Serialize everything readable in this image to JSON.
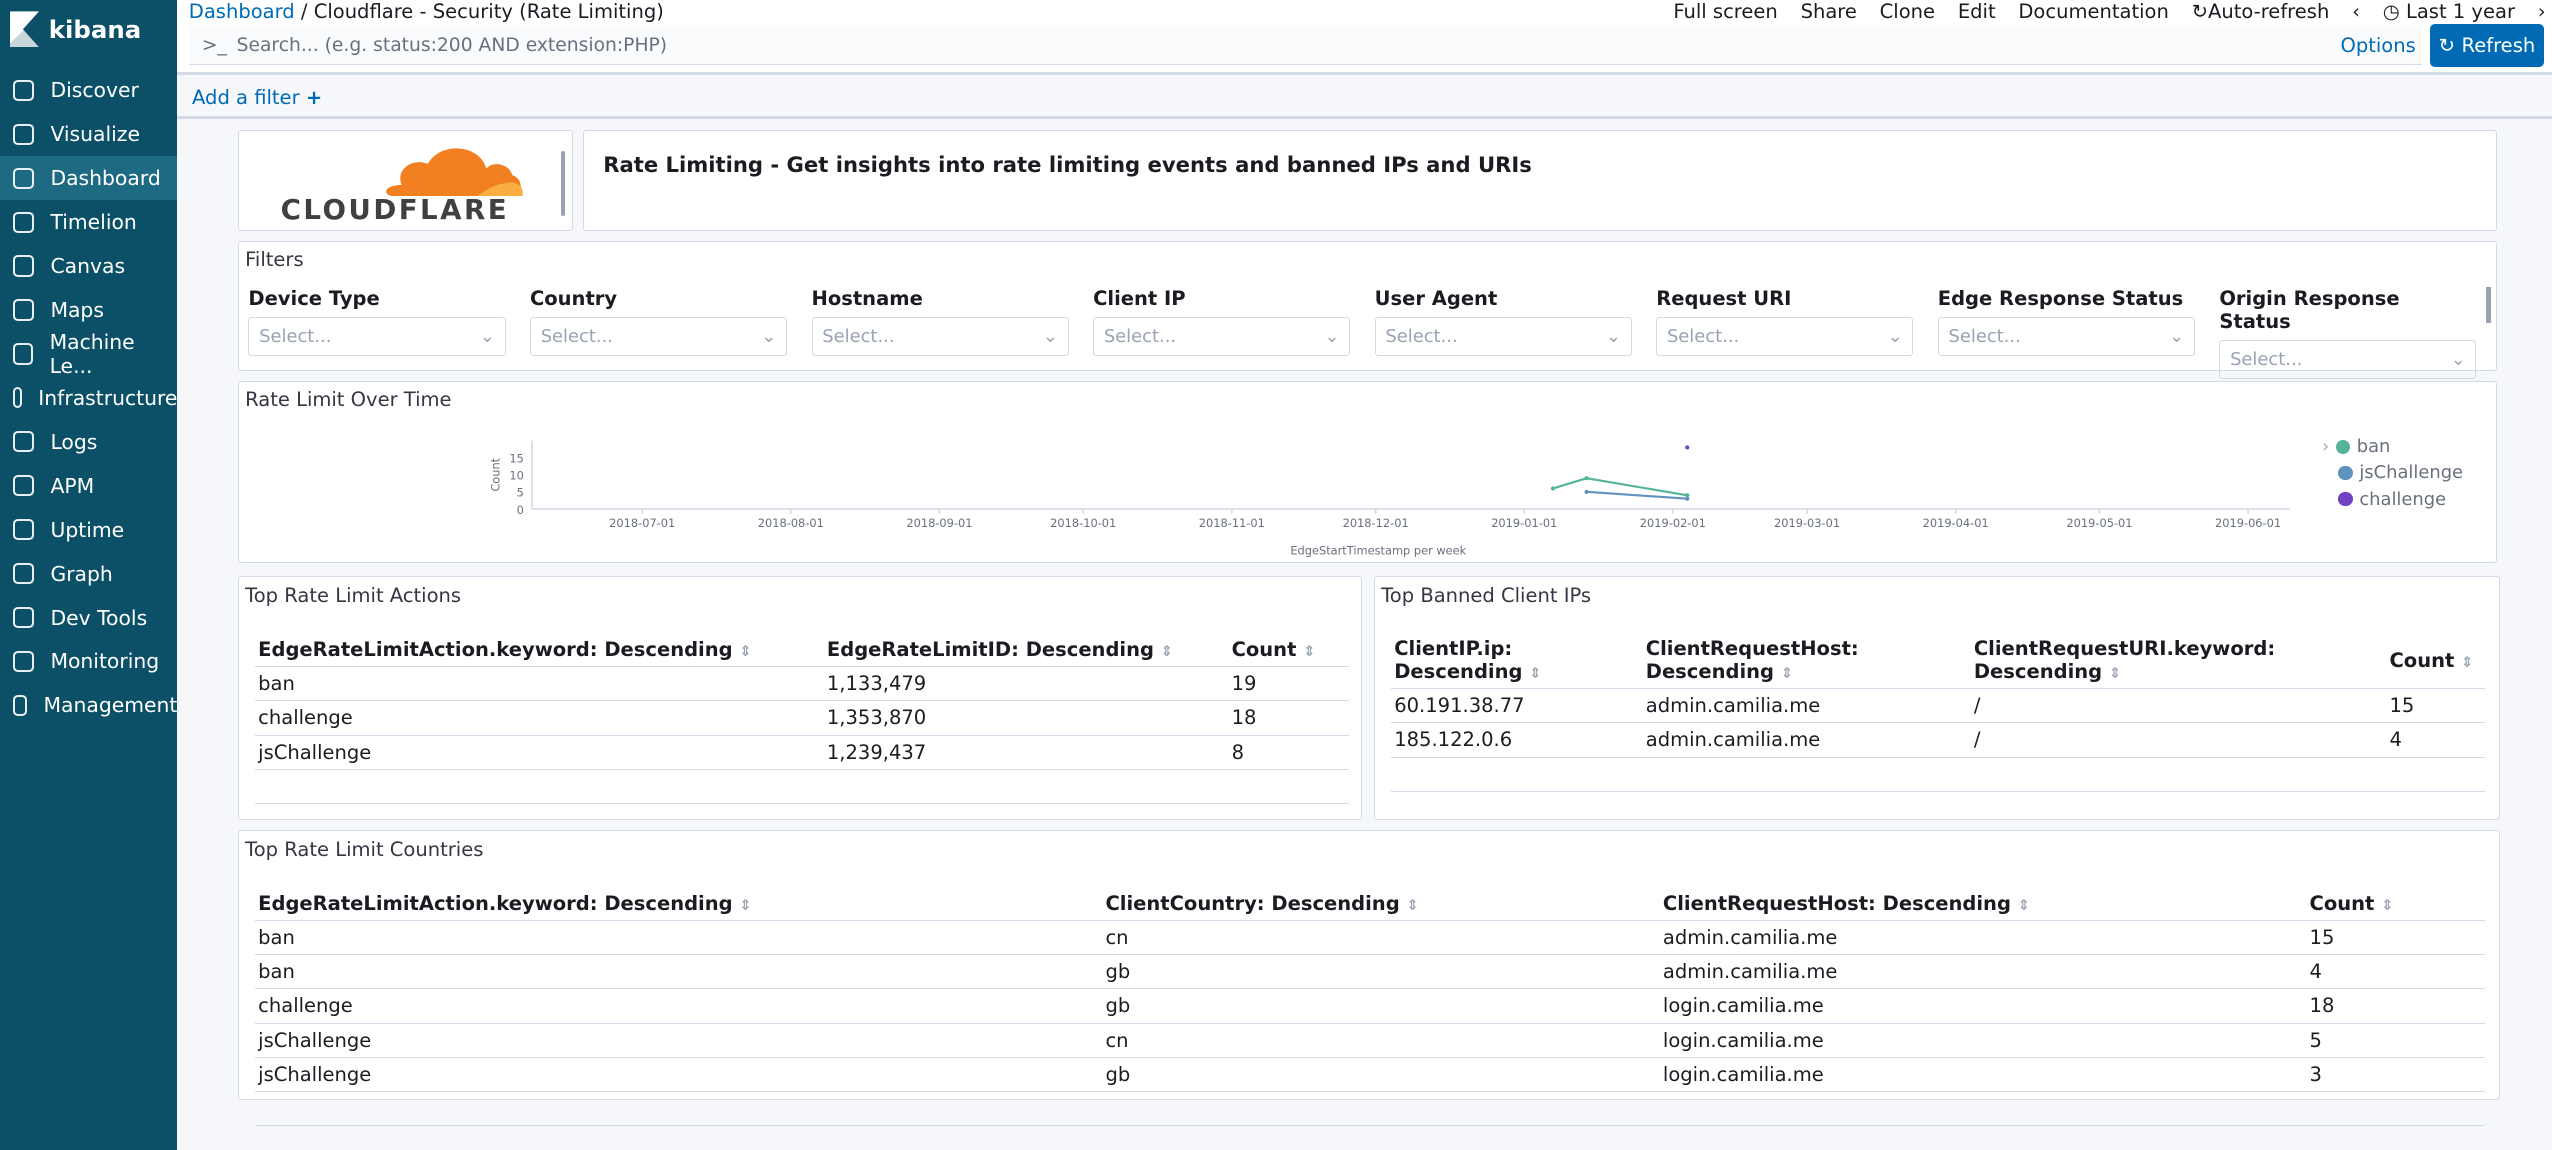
{
  "sidebar": {
    "brand": "kibana",
    "items": [
      {
        "label": "Discover"
      },
      {
        "label": "Visualize"
      },
      {
        "label": "Dashboard",
        "active": true
      },
      {
        "label": "Timelion"
      },
      {
        "label": "Canvas"
      },
      {
        "label": "Maps"
      },
      {
        "label": "Machine Le..."
      },
      {
        "label": "Infrastructure"
      },
      {
        "label": "Logs"
      },
      {
        "label": "APM"
      },
      {
        "label": "Uptime"
      },
      {
        "label": "Graph"
      },
      {
        "label": "Dev Tools"
      },
      {
        "label": "Monitoring"
      },
      {
        "label": "Management"
      }
    ]
  },
  "header": {
    "breadcrumb_root": "Dashboard",
    "breadcrumb_sep": "/",
    "breadcrumb_current": "Cloudflare - Security (Rate Limiting)",
    "menu": [
      "Full screen",
      "Share",
      "Clone",
      "Edit",
      "Documentation",
      "Auto-refresh"
    ],
    "time_range": "Last 1 year",
    "search_prompt": ">_",
    "search_placeholder": "Search... (e.g. status:200 AND extension:PHP)",
    "options": "Options",
    "refresh": "Refresh",
    "add_filter": "Add a filter"
  },
  "logo": {
    "text": "CLOUDFLARE",
    "color": "#f38020"
  },
  "title_panel": {
    "text": "Rate Limiting - Get insights into rate limiting events and banned IPs and URIs"
  },
  "filters": {
    "title": "Filters",
    "controls": [
      {
        "label": "Device Type",
        "placeholder": "Select..."
      },
      {
        "label": "Country",
        "placeholder": "Select..."
      },
      {
        "label": "Hostname",
        "placeholder": "Select..."
      },
      {
        "label": "Client IP",
        "placeholder": "Select..."
      },
      {
        "label": "User Agent",
        "placeholder": "Select..."
      },
      {
        "label": "Request URI",
        "placeholder": "Select..."
      },
      {
        "label": "Edge Response Status",
        "placeholder": "Select..."
      },
      {
        "label": "Origin Response Status",
        "placeholder": "Select..."
      }
    ]
  },
  "chart_data": {
    "type": "line",
    "title": "Rate Limit Over Time",
    "xlabel": "EdgeStartTimestamp per week",
    "ylabel": "Count",
    "ylim": [
      0,
      20
    ],
    "yticks": [
      0,
      5,
      10,
      15
    ],
    "xticks": [
      "2018-07-01",
      "2018-08-01",
      "2018-09-01",
      "2018-10-01",
      "2018-11-01",
      "2018-12-01",
      "2019-01-01",
      "2019-02-01",
      "2019-03-01",
      "2019-04-01",
      "2019-05-01",
      "2019-06-01"
    ],
    "xlim": [
      "2018-06-08",
      "2019-06-08"
    ],
    "legend": "right",
    "series": [
      {
        "name": "ban",
        "color": "#54b399",
        "points": [
          [
            "2019-01-07",
            6
          ],
          [
            "2019-01-14",
            9
          ],
          [
            "2019-02-04",
            4
          ]
        ]
      },
      {
        "name": "jsChallenge",
        "color": "#6092c0",
        "points": [
          [
            "2019-01-14",
            5
          ],
          [
            "2019-02-04",
            3
          ]
        ]
      },
      {
        "name": "challenge",
        "color": "#6f42c1",
        "points": [
          [
            "2019-02-04",
            18
          ]
        ]
      }
    ]
  },
  "actions_table": {
    "title": "Top Rate Limit Actions",
    "columns": [
      "EdgeRateLimitAction.keyword: Descending",
      "EdgeRateLimitID: Descending",
      "Count"
    ],
    "rows": [
      [
        "ban",
        "1,133,479",
        "19"
      ],
      [
        "challenge",
        "1,353,870",
        "18"
      ],
      [
        "jsChallenge",
        "1,239,437",
        "8"
      ]
    ]
  },
  "ips_table": {
    "title": "Top Banned Client IPs",
    "columns": [
      "ClientIP.ip: Descending",
      "ClientRequestHost: Descending",
      "ClientRequestURI.keyword: Descending",
      "Count"
    ],
    "rows": [
      [
        "60.191.38.77",
        "admin.camilia.me",
        "/",
        "15"
      ],
      [
        "185.122.0.6",
        "admin.camilia.me",
        "/",
        "4"
      ]
    ]
  },
  "countries_table": {
    "title": "Top Rate Limit Countries",
    "columns": [
      "EdgeRateLimitAction.keyword: Descending",
      "ClientCountry: Descending",
      "ClientRequestHost: Descending",
      "Count"
    ],
    "rows": [
      [
        "ban",
        "cn",
        "admin.camilia.me",
        "15"
      ],
      [
        "ban",
        "gb",
        "admin.camilia.me",
        "4"
      ],
      [
        "challenge",
        "gb",
        "login.camilia.me",
        "18"
      ],
      [
        "jsChallenge",
        "cn",
        "login.camilia.me",
        "5"
      ],
      [
        "jsChallenge",
        "gb",
        "login.camilia.me",
        "3"
      ]
    ]
  }
}
